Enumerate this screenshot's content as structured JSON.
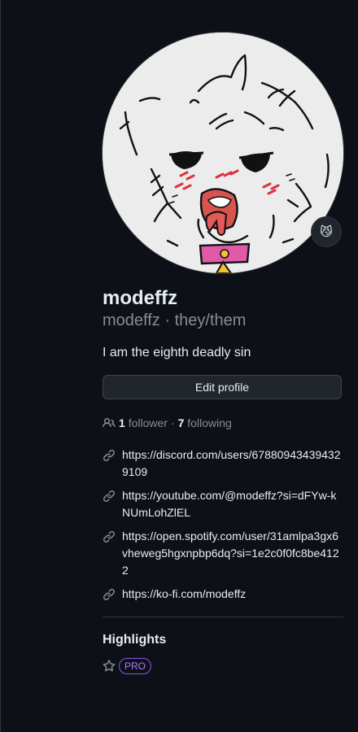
{
  "profile": {
    "display_name": "modeffz",
    "username": "modeffz",
    "separator": "·",
    "pronouns": "they/them",
    "bio": "I am the eighth deadly sin",
    "status_emoji": "😼",
    "avatar_icon": "cartoon-cat-avatar"
  },
  "actions": {
    "edit_profile_label": "Edit profile"
  },
  "follow": {
    "followers_count": "1",
    "followers_label": "follower",
    "separator": "·",
    "following_count": "7",
    "following_label": "following"
  },
  "links": [
    "https://discord.com/users/678809434394329109",
    "https://youtube.com/@modeffz?si=dFYw-kNUmLohZlEL",
    "https://open.spotify.com/user/31amlpa3gx6vheweg5hgxnpbp6dq?si=1e2c0f0fc8be4122",
    "https://ko-fi.com/modeffz"
  ],
  "highlights": {
    "title": "Highlights",
    "badge": "PRO",
    "badge_color": "#8957e5"
  },
  "colors": {
    "background": "#0d1117",
    "text": "#e6edf3",
    "muted": "#848d97",
    "border": "#30363d"
  }
}
